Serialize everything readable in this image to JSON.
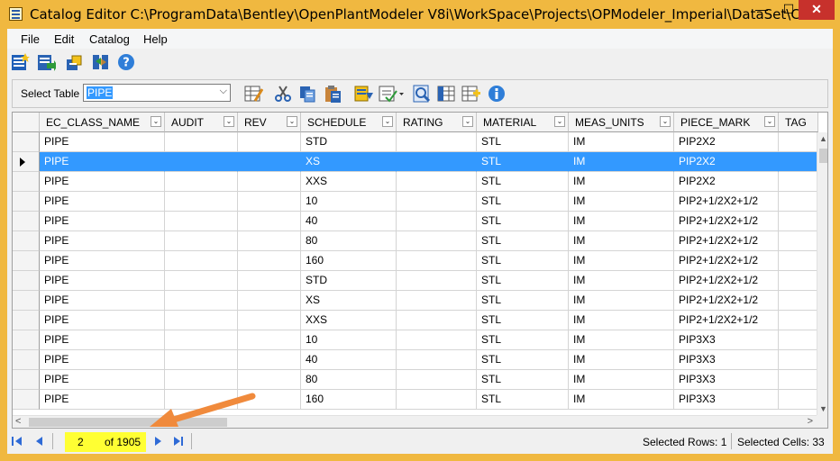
{
  "window": {
    "title": "Catalog Editor C:\\ProgramData\\Bentley\\OpenPlantModeler V8i\\WorkSpace\\Projects\\OPModeler_Imperial\\DataSet\\Ca...",
    "minimize": "—",
    "maximize": "☐",
    "close": "✕"
  },
  "menu": {
    "items": [
      "File",
      "Edit",
      "Catalog",
      "Help"
    ]
  },
  "toolbar2": {
    "select_label": "Select Table",
    "table_value": "PIPE",
    "combo_arrow": "⌵"
  },
  "grid": {
    "columns": [
      "EC_CLASS_NAME",
      "AUDIT",
      "REV",
      "SCHEDULE",
      "RATING",
      "MATERIAL",
      "MEAS_UNITS",
      "PIECE_MARK",
      "TAG"
    ],
    "dropdown_glyph": "⌄",
    "rows": [
      [
        "PIPE",
        "",
        "",
        "STD",
        "",
        "STL",
        "IM",
        "PIP2X2",
        ""
      ],
      [
        "PIPE",
        "",
        "",
        "XS",
        "",
        "STL",
        "IM",
        "PIP2X2",
        ""
      ],
      [
        "PIPE",
        "",
        "",
        "XXS",
        "",
        "STL",
        "IM",
        "PIP2X2",
        ""
      ],
      [
        "PIPE",
        "",
        "",
        "10",
        "",
        "STL",
        "IM",
        "PIP2+1/2X2+1/2",
        ""
      ],
      [
        "PIPE",
        "",
        "",
        "40",
        "",
        "STL",
        "IM",
        "PIP2+1/2X2+1/2",
        ""
      ],
      [
        "PIPE",
        "",
        "",
        "80",
        "",
        "STL",
        "IM",
        "PIP2+1/2X2+1/2",
        ""
      ],
      [
        "PIPE",
        "",
        "",
        "160",
        "",
        "STL",
        "IM",
        "PIP2+1/2X2+1/2",
        ""
      ],
      [
        "PIPE",
        "",
        "",
        "STD",
        "",
        "STL",
        "IM",
        "PIP2+1/2X2+1/2",
        ""
      ],
      [
        "PIPE",
        "",
        "",
        "XS",
        "",
        "STL",
        "IM",
        "PIP2+1/2X2+1/2",
        ""
      ],
      [
        "PIPE",
        "",
        "",
        "XXS",
        "",
        "STL",
        "IM",
        "PIP2+1/2X2+1/2",
        ""
      ],
      [
        "PIPE",
        "",
        "",
        "10",
        "",
        "STL",
        "IM",
        "PIP3X3",
        ""
      ],
      [
        "PIPE",
        "",
        "",
        "40",
        "",
        "STL",
        "IM",
        "PIP3X3",
        ""
      ],
      [
        "PIPE",
        "",
        "",
        "80",
        "",
        "STL",
        "IM",
        "PIP3X3",
        ""
      ],
      [
        "PIPE",
        "",
        "",
        "160",
        "",
        "STL",
        "IM",
        "PIP3X3",
        ""
      ]
    ],
    "selected_row_index": 1,
    "scroll_up": "▲",
    "scroll_down": "▼",
    "scroll_left": "<",
    "scroll_right": ">"
  },
  "navigator": {
    "position": "2",
    "of_text": "of 1905"
  },
  "status": {
    "selected_rows": "Selected Rows:  1",
    "selected_cells": "Selected Cells:  33"
  },
  "colors": {
    "frame": "#f0b840",
    "selection": "#3399ff",
    "position_highlight": "#ffff33",
    "annotation_arrow": "#f08a3c",
    "nav_blue": "#2e6ad6"
  },
  "icons": {
    "toolbar1": [
      "new-catalog-icon",
      "import-icon",
      "export-catalog-icon",
      "compare-icon",
      "help-icon"
    ],
    "toolbar2": [
      "edit-table-icon",
      "cut-icon",
      "copy-icon",
      "paste-icon",
      "filter-icon",
      "form-view-icon",
      "find-icon",
      "column-view-icon",
      "add-column-icon",
      "info-icon"
    ]
  }
}
